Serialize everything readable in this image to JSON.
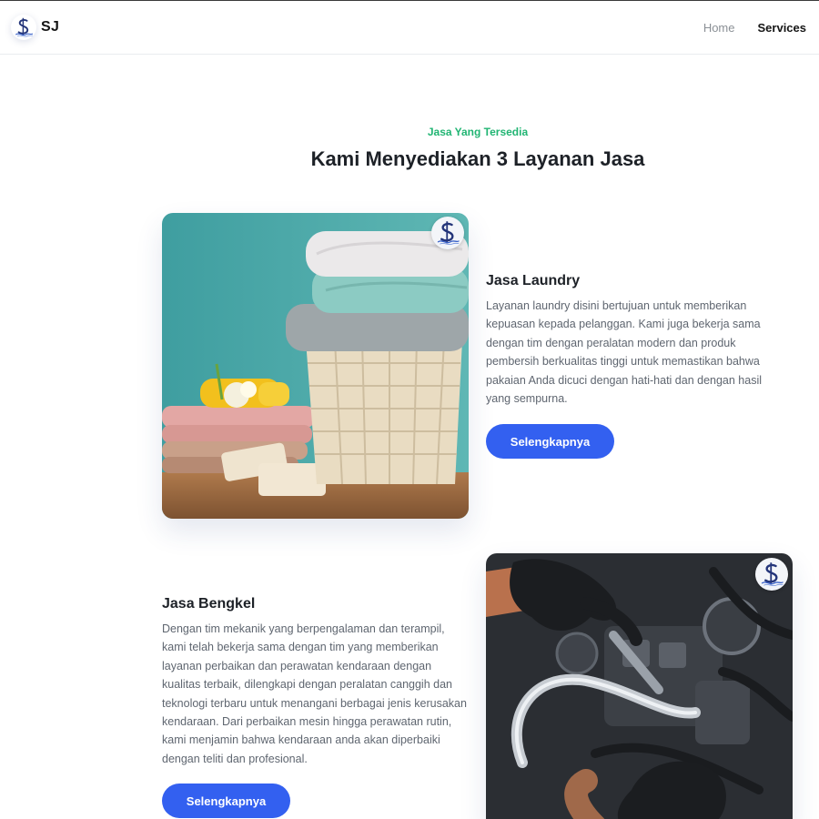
{
  "header": {
    "brand": "SJ",
    "nav": [
      {
        "label": "Home"
      },
      {
        "label": "Services"
      }
    ]
  },
  "section": {
    "eyebrow": "Jasa Yang Tersedia",
    "title": "Kami Menyediakan 3 Layanan Jasa"
  },
  "services": [
    {
      "title": "Jasa Laundry",
      "description": "Layanan laundry disini bertujuan untuk memberikan kepuasan kepada pelanggan. Kami juga bekerja sama dengan tim dengan peralatan modern dan produk pembersih berkualitas tinggi untuk memastikan bahwa pakaian Anda dicuci dengan hati-hati dan dengan hasil yang sempurna.",
      "button": "Selengkapnya",
      "image": "laundry-basket-towels-photo"
    },
    {
      "title": "Jasa Bengkel",
      "description": "Dengan tim mekanik yang berpengalaman dan terampil, kami telah bekerja sama dengan tim yang memberikan layanan perbaikan dan perawatan kendaraan dengan kualitas terbaik, dilengkapi dengan peralatan canggih dan teknologi terbaru untuk menangani berbagai jenis kerusakan kendaraan. Dari perbaikan mesin hingga perawatan rutin, kami menjamin bahwa kendaraan anda akan diperbaiki dengan teliti dan profesional.",
      "button": "Selengkapnya",
      "image": "mechanic-engine-repair-photo"
    }
  ],
  "colors": {
    "accent_green": "#21b573",
    "button_blue": "#3360f0",
    "logo_navy": "#24357a"
  },
  "icons": [
    "dollar-s-logo-icon"
  ]
}
